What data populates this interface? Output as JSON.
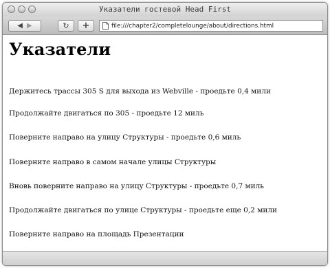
{
  "window": {
    "title": "Указатели гостевой Head First"
  },
  "toolbar": {
    "back_label": "◀",
    "forward_label": "▶",
    "reload_label": "↻",
    "add_label": "+",
    "url": "file:///chapter2/completelounge/about/directions.html"
  },
  "page": {
    "heading": "Указатели",
    "directions": [
      "Держитесь трассы 305 S для выхода из Webville - проедьте 0,4 мили",
      "Продолжайте двигаться по 305 - проедьте 12 миль",
      "Поверните направо на улицу Структуры - проедьте 0,6 миль",
      "Поверните направо в самом начале улицы Структуры",
      "Вновь поверните направо на улицу Структуры - проедьте 0,7 миль",
      "Продолжайте двигаться по улице Структуры - проедьте еще 0,2 мили",
      "Поверните направо на площадь Презентации"
    ]
  }
}
